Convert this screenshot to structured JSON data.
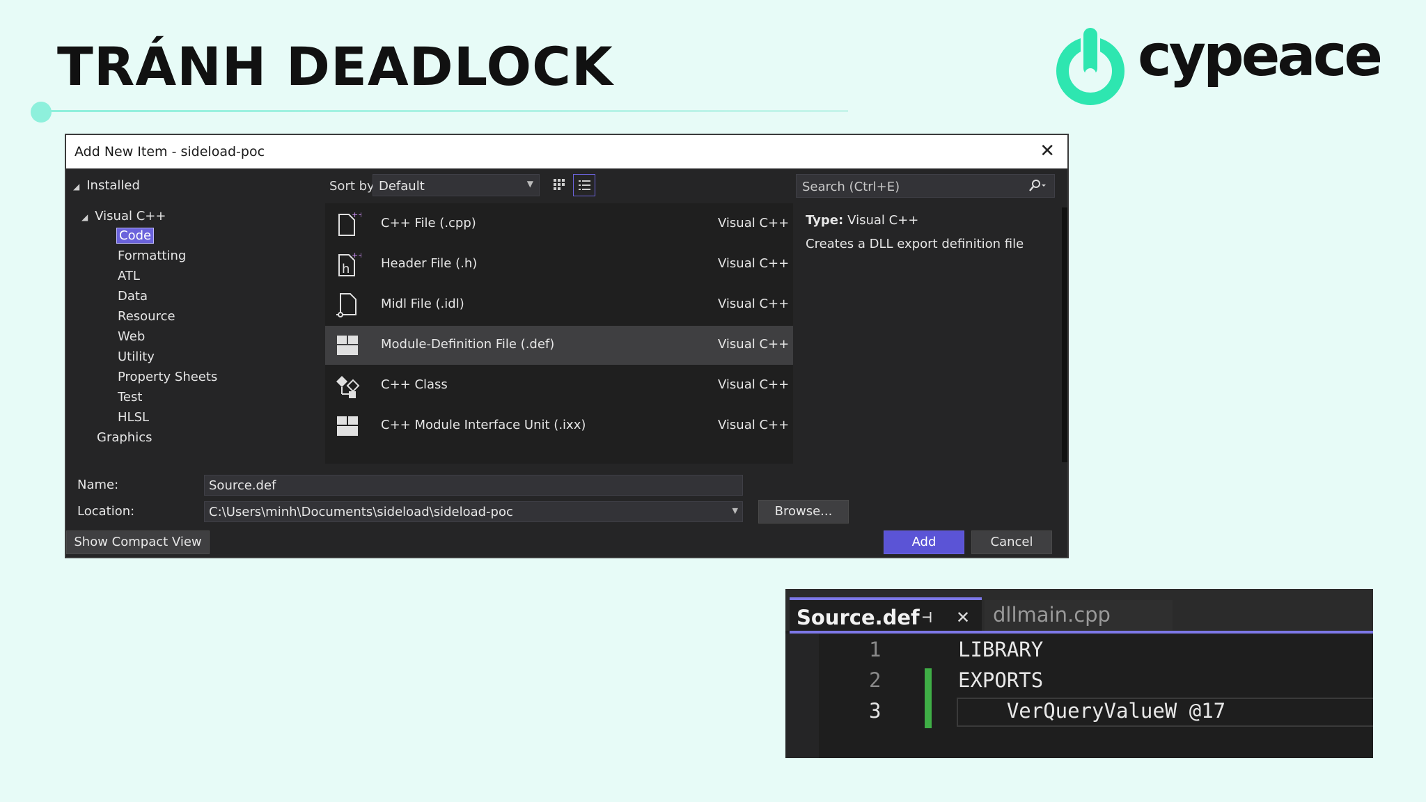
{
  "slide": {
    "title": "TRÁNH DEADLOCK",
    "brand": "cypeace",
    "accent_color": "#8ef0dc",
    "brand_color": "#2ee6b0"
  },
  "dialog": {
    "title": "Add New Item - sideload-poc",
    "close_icon": "close-icon",
    "tree": {
      "root": "Installed",
      "group": "Visual C++",
      "children": [
        "Code",
        "Formatting",
        "ATL",
        "Data",
        "Resource",
        "Web",
        "Utility",
        "Property Sheets",
        "Test",
        "HLSL"
      ],
      "selected": "Code",
      "extra": "Graphics"
    },
    "toolbar": {
      "sort_label": "Sort by:",
      "sort_value": "Default",
      "search_placeholder": "Search (Ctrl+E)"
    },
    "items": [
      {
        "name": "C++ File (.cpp)",
        "lang": "Visual C++",
        "icon": "cpp-file-icon"
      },
      {
        "name": "Header File (.h)",
        "lang": "Visual C++",
        "icon": "header-file-icon"
      },
      {
        "name": "Midl File (.idl)",
        "lang": "Visual C++",
        "icon": "midl-file-icon"
      },
      {
        "name": "Module-Definition File (.def)",
        "lang": "Visual C++",
        "icon": "module-definition-icon",
        "selected": true
      },
      {
        "name": "C++ Class",
        "lang": "Visual C++",
        "icon": "cpp-class-icon"
      },
      {
        "name": "C++ Module Interface Unit (.ixx)",
        "lang": "Visual C++",
        "icon": "module-interface-icon"
      }
    ],
    "details": {
      "type_label": "Type:",
      "type_value": "Visual C++",
      "description": "Creates a DLL export definition file"
    },
    "form": {
      "name_label": "Name:",
      "name_value": "Source.def",
      "location_label": "Location:",
      "location_value": "C:\\Users\\minh\\Documents\\sideload\\sideload-poc",
      "browse_label": "Browse...",
      "compact_view_label": "Show Compact View",
      "add_label": "Add",
      "cancel_label": "Cancel"
    }
  },
  "editor": {
    "active_tab": "Source.def",
    "inactive_tab": "dllmain.cpp",
    "lines": [
      {
        "no": "1",
        "text": "LIBRARY"
      },
      {
        "no": "2",
        "text": "EXPORTS"
      },
      {
        "no": "3",
        "text": "    VerQueryValueW @17"
      }
    ]
  }
}
